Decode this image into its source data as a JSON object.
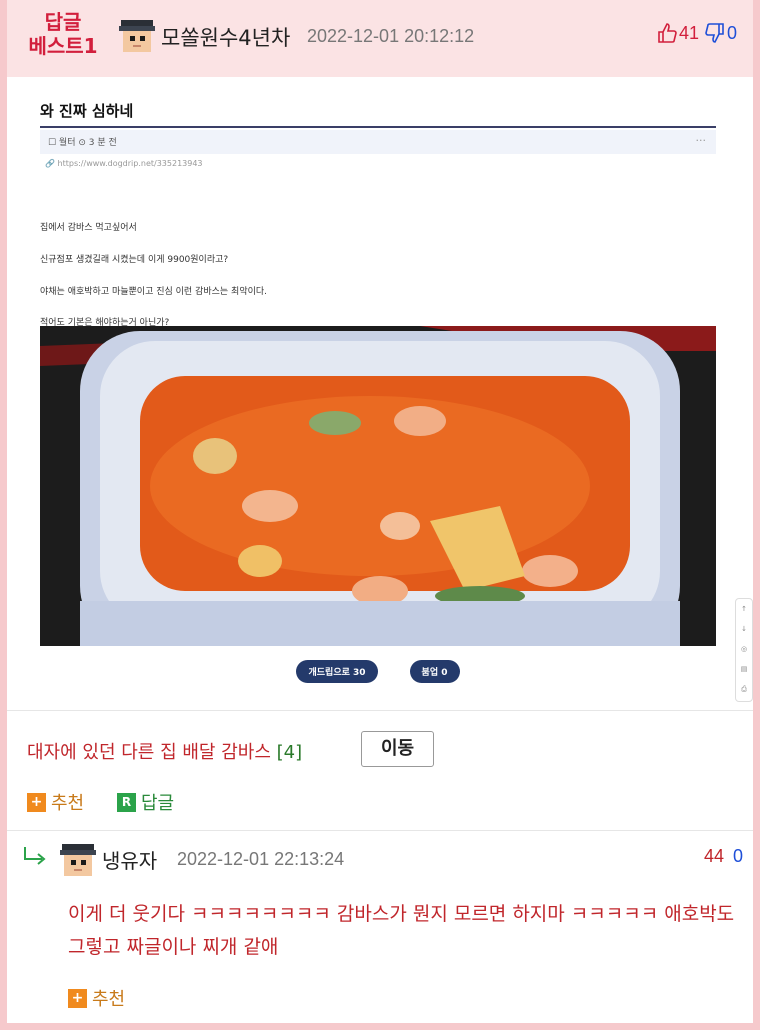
{
  "header": {
    "badge_line1": "답글",
    "badge_line2": "베스트1",
    "author": "모쏠원수4년차",
    "date": "2022-12-01 20:12:12",
    "upvotes": "41",
    "downvotes": "0"
  },
  "embed": {
    "title": "와 진짜 심하네",
    "meta": "☐ 월터   ⊙ 3 분 전",
    "meta_more": "···",
    "url": "https://www.dogdrip.net/335213943",
    "lines": [
      "집에서 감바스 먹고싶어서",
      "신규점포 생겼길래 시켰는데 이게 9900원이라고?",
      "야채는 애호박하고 마늘뿐이고 진심 이런 감바스는 최악이다.",
      "적어도 기본은 해야하는거 아닌가?"
    ],
    "like_button": "개드립으로 30",
    "dislike_button": "붐업 0",
    "side_tools": [
      "↑",
      "↓",
      "◎",
      "▤",
      "⎙"
    ]
  },
  "post_link": {
    "title": "대자에 있던 다른 집 배달 감바스",
    "count": "[4]",
    "move_label": "이동"
  },
  "actions": {
    "recommend": "추천",
    "reply": "답글",
    "plus_icon": "+",
    "reply_icon": "R"
  },
  "comment": {
    "author": "냉유자",
    "date": "2022-12-01 22:13:24",
    "upvotes": "44",
    "downvotes": "0",
    "body": "이게 더 웃기다 ㅋㅋㅋㅋㅋㅋㅋㅋ 감바스가 뭔지 모르면 하지마 ㅋㅋㅋㅋㅋ 애호박도 그렇고 짜글이나 찌개 같애",
    "recommend": "추천"
  },
  "colors": {
    "accent_red": "#d21f3c",
    "down_blue": "#1e4fd8",
    "header_bg": "#fbe3e4",
    "plus_orange": "#f08a1e",
    "reply_green": "#2ba34a"
  }
}
